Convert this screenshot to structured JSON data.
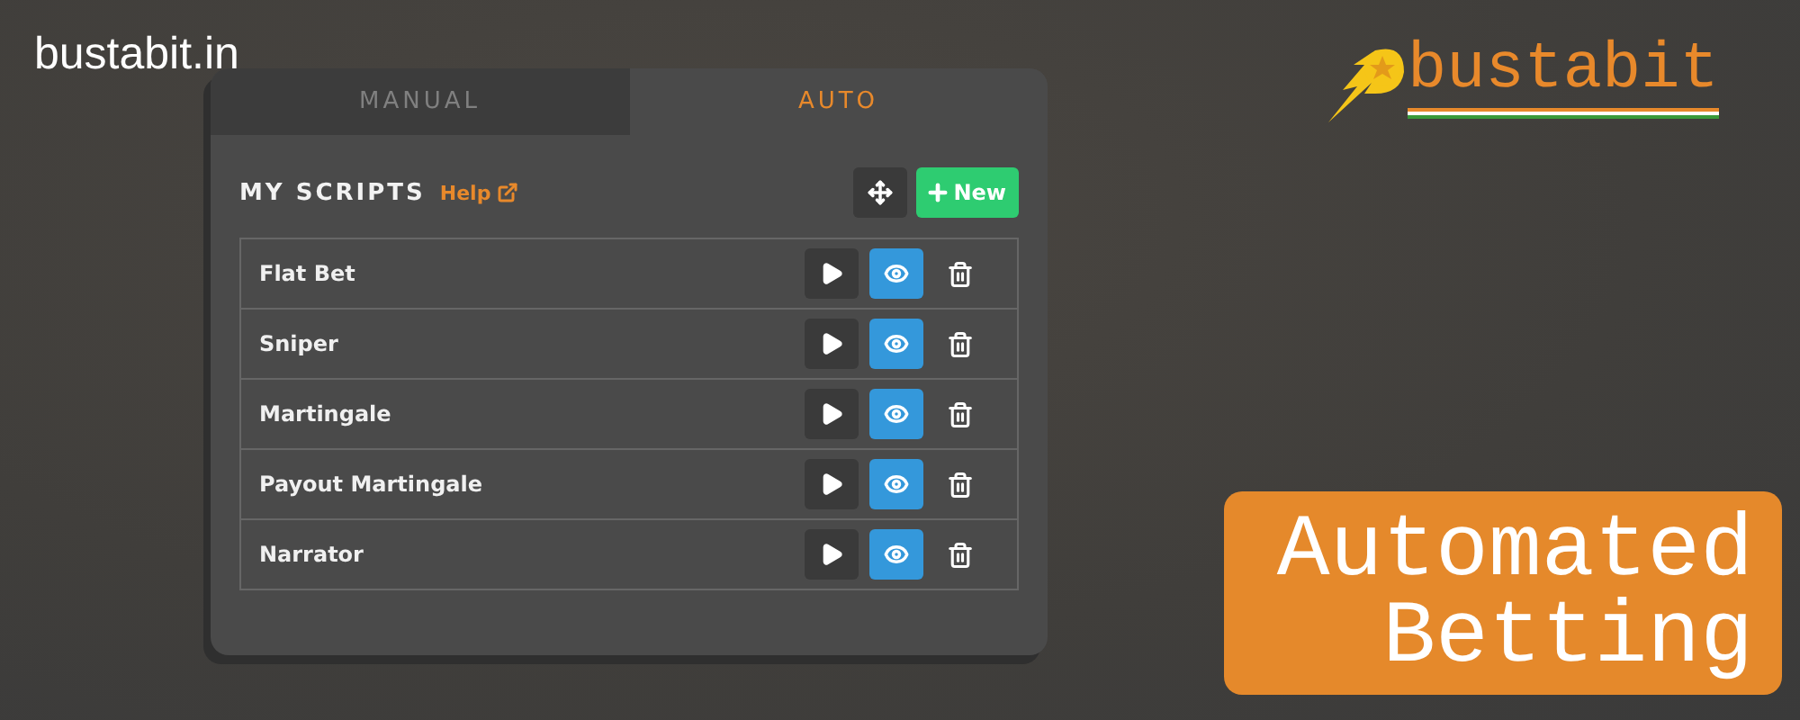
{
  "site_label": "bustabit.in",
  "logo": {
    "text": "bustabit"
  },
  "panel": {
    "tabs": [
      {
        "label": "MANUAL",
        "selected": false
      },
      {
        "label": "AUTO",
        "selected": true
      }
    ],
    "heading": "MY SCRIPTS",
    "help_link": "Help",
    "new_button": "New",
    "scripts": [
      {
        "name": "Flat Bet"
      },
      {
        "name": "Sniper"
      },
      {
        "name": "Martingale"
      },
      {
        "name": "Payout Martingale"
      },
      {
        "name": "Narrator"
      }
    ]
  },
  "badge": {
    "lines": [
      "Automated",
      "Betting"
    ]
  }
}
